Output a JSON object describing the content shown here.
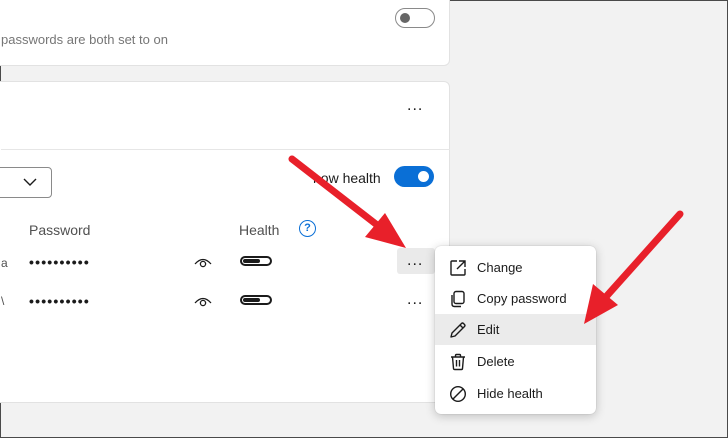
{
  "settings_card": {
    "description_fragment": "passwords are both set to on",
    "toggle_state": "off"
  },
  "passwords_card": {
    "more_label": "...",
    "show_health_label": "how health",
    "show_health_state": "on",
    "columns": {
      "password": "Password",
      "health": "Health",
      "help_symbol": "?"
    },
    "rows": [
      {
        "site_fragment": "a",
        "masked_password": "••••••••••",
        "row_more_label": "..."
      },
      {
        "site_fragment": "\\",
        "masked_password": "••••••••••",
        "row_more_label": "..."
      }
    ]
  },
  "context_menu": {
    "items": [
      {
        "label": "Change",
        "icon": "open-external-icon"
      },
      {
        "label": "Copy password",
        "icon": "copy-icon"
      },
      {
        "label": "Edit",
        "icon": "pencil-icon",
        "highlighted": true
      },
      {
        "label": "Delete",
        "icon": "trash-icon"
      },
      {
        "label": "Hide health",
        "icon": "block-icon"
      }
    ]
  },
  "colors": {
    "accent": "#0a6fd6",
    "annotation_arrow": "#e8202a",
    "menu_highlight": "#ebebeb"
  }
}
